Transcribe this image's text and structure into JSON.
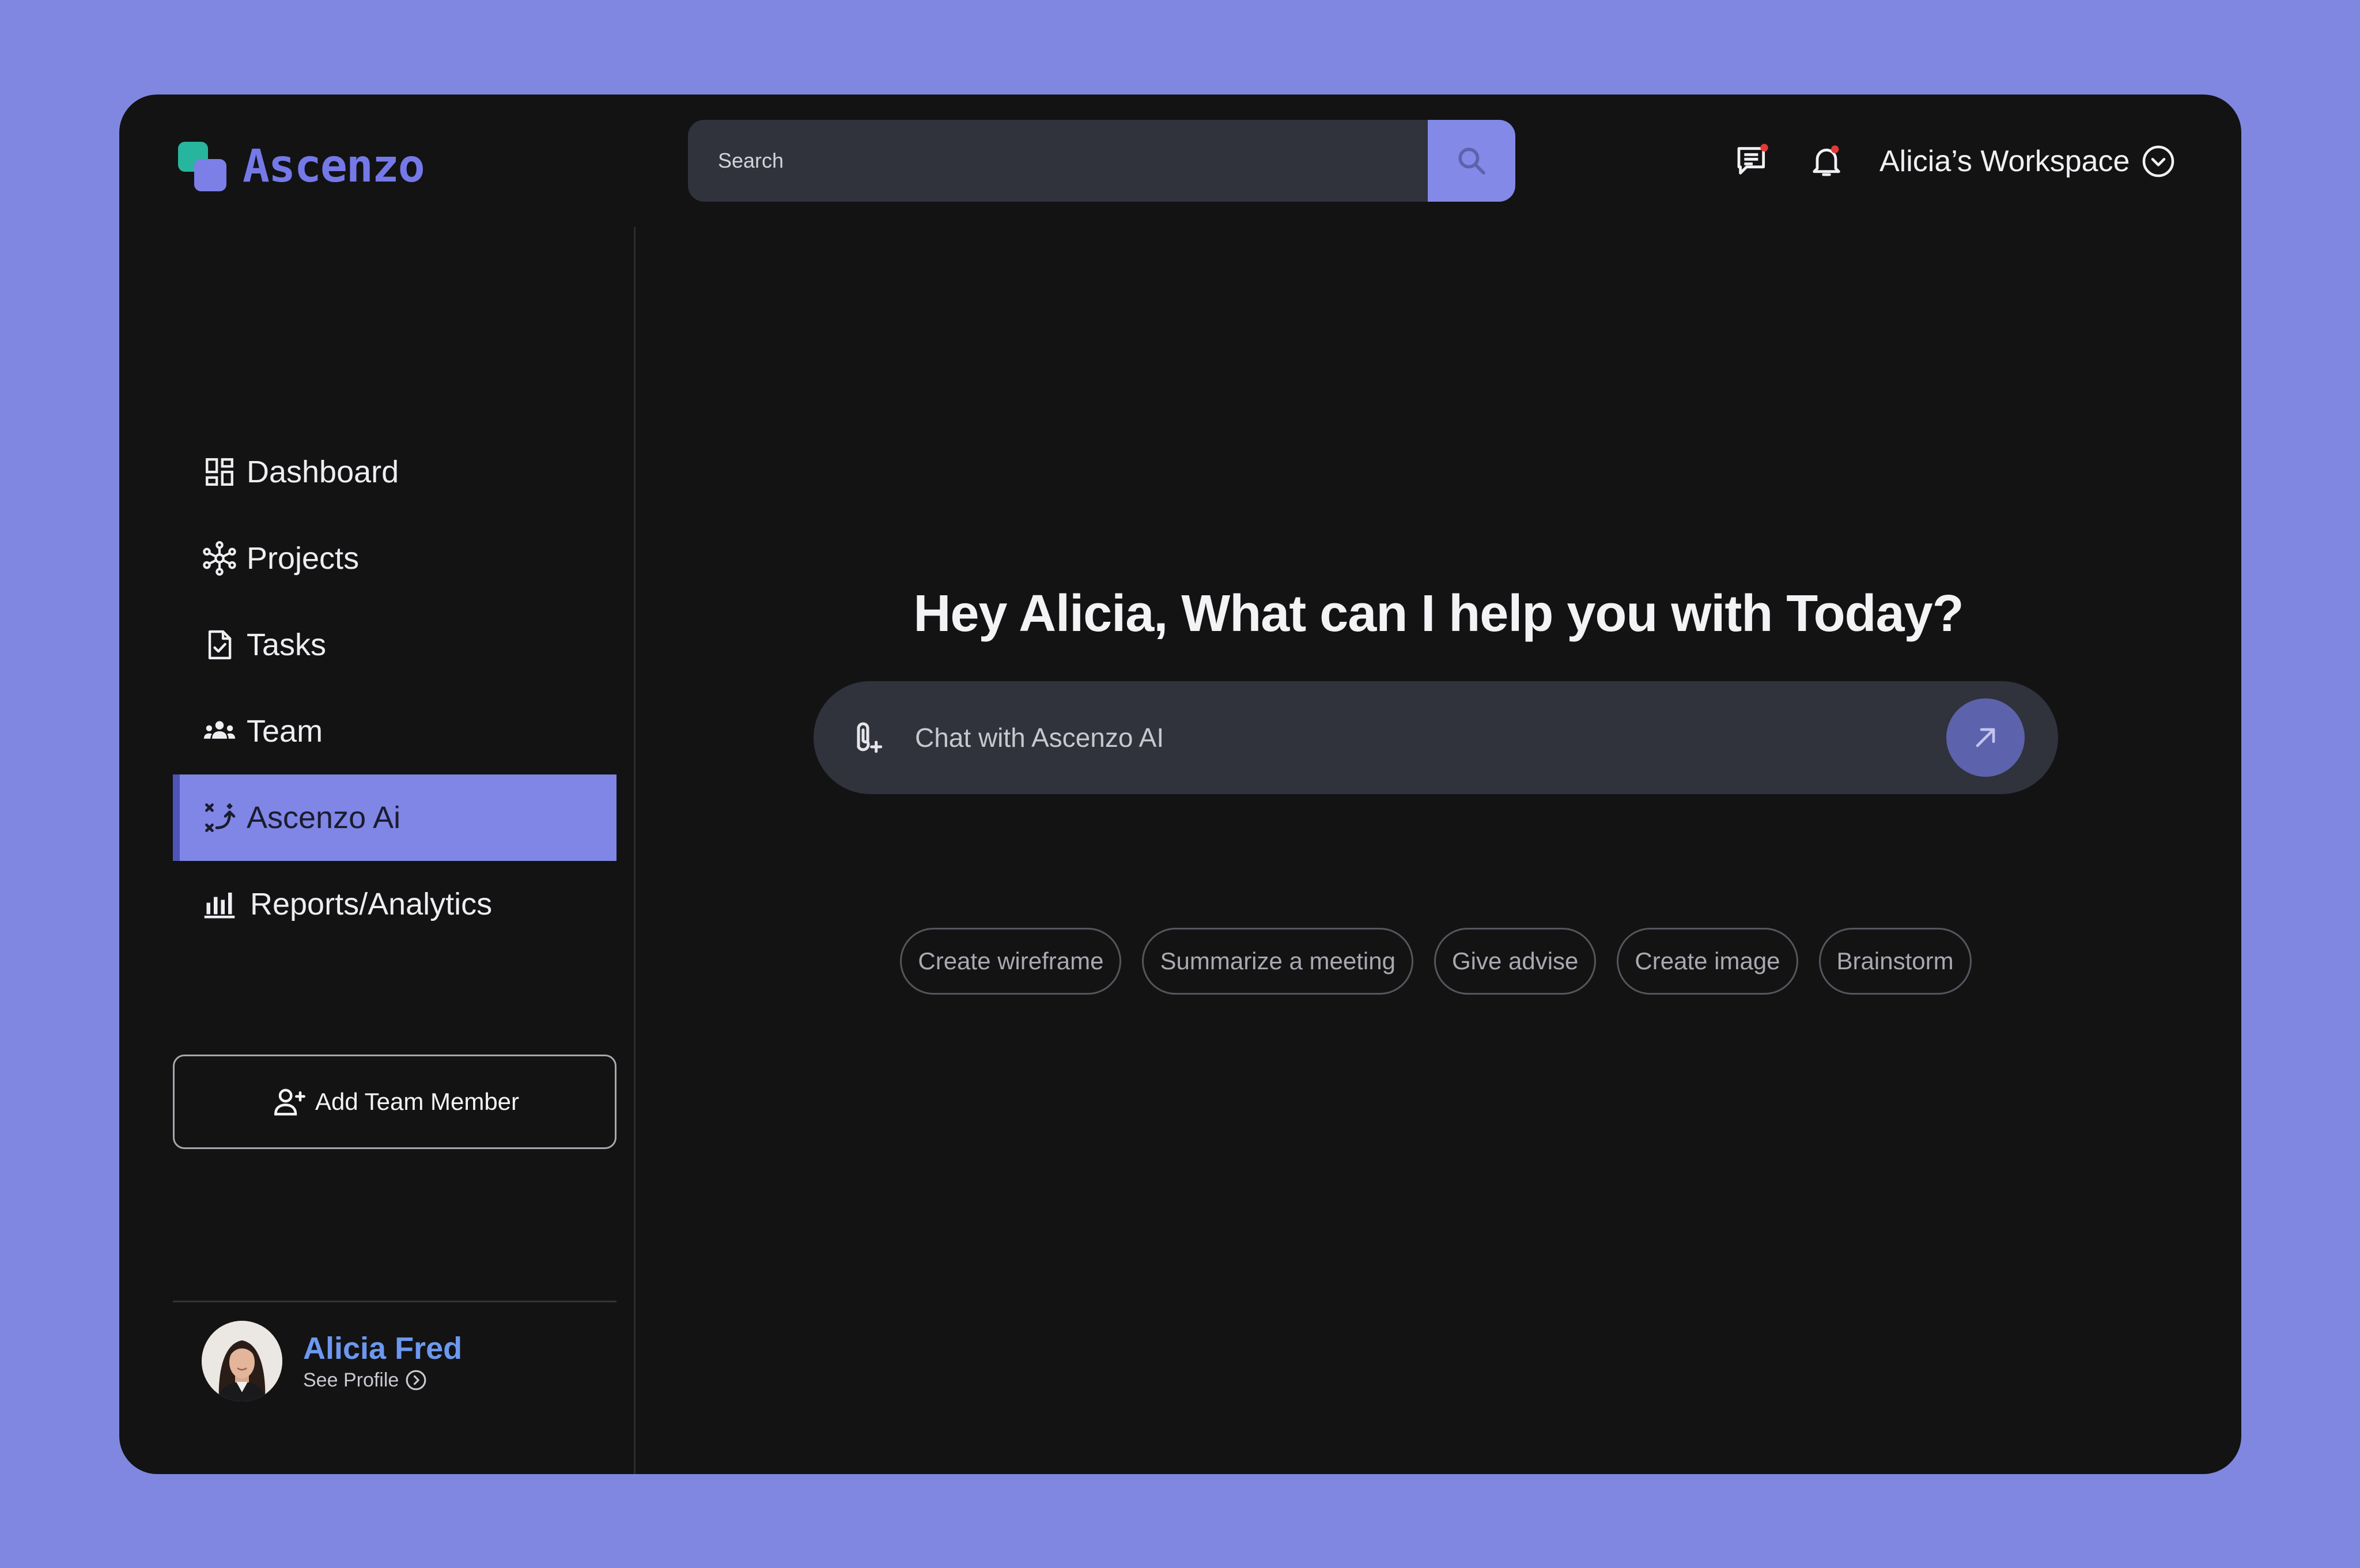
{
  "brand": {
    "name": "Ascenzo",
    "colors": {
      "teal": "#28b59d",
      "purple": "#7b7fe6",
      "accent": "#7f86e6"
    }
  },
  "search": {
    "placeholder": "Search",
    "button_icon": "search-icon"
  },
  "header": {
    "chat_icon": "messages-icon",
    "notification_icon": "bell-icon",
    "notification_dot_color": "#e53935",
    "workspace_label": "Alicia’s Workspace",
    "workspace_icon": "chevron-down-circle-icon"
  },
  "sidebar": {
    "items": [
      {
        "label": "Dashboard",
        "icon": "dashboard-icon",
        "active": false
      },
      {
        "label": "Projects",
        "icon": "projects-icon",
        "active": false
      },
      {
        "label": "Tasks",
        "icon": "tasks-icon",
        "active": false
      },
      {
        "label": "Team",
        "icon": "team-icon",
        "active": false
      },
      {
        "label": "Ascenzo Ai",
        "icon": "ai-icon",
        "active": true
      },
      {
        "label": "Reports/Analytics",
        "icon": "analytics-icon",
        "active": false
      }
    ],
    "add_member_label": "Add Team Member",
    "add_member_icon": "add-user-icon"
  },
  "profile": {
    "name": "Alicia Fred",
    "link_label": "See Profile",
    "link_icon": "chevron-right-circle-icon"
  },
  "main": {
    "greeting": "Hey Alicia, What can I help you with Today?",
    "chat": {
      "placeholder": "Chat with Ascenzo AI",
      "attach_icon": "attach-icon",
      "send_icon": "arrow-up-right-icon"
    },
    "suggestions": [
      "Create wireframe",
      "Summarize a meeting",
      "Give advise",
      "Create image",
      "Brainstorm"
    ]
  }
}
